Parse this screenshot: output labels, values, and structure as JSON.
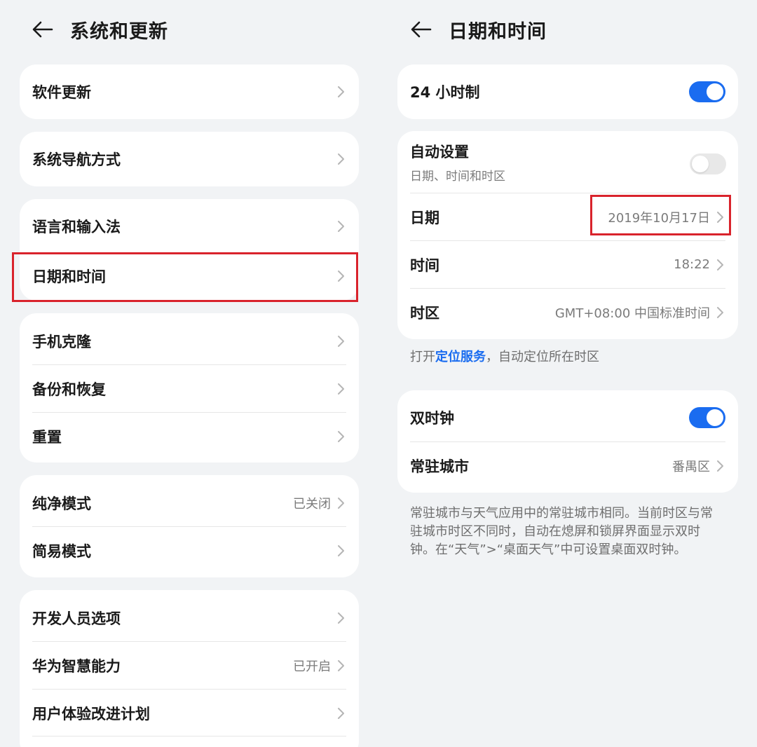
{
  "colors": {
    "background": "#f1f3f5",
    "accent": "#1a6cf0",
    "highlight": "#d9232c"
  },
  "left": {
    "title": "系统和更新",
    "rows": {
      "software_update": "软件更新",
      "system_navigation": "系统导航方式",
      "language_input": "语言和输入法",
      "date_time": "日期和时间",
      "phone_clone": "手机克隆",
      "backup_restore": "备份和恢复",
      "reset": "重置",
      "pure_mode": "纯净模式",
      "pure_mode_value": "已关闭",
      "simple_mode": "简易模式",
      "developer_options": "开发人员选项",
      "huawei_ai": "华为智慧能力",
      "huawei_ai_value": "已开启",
      "ux_plan": "用户体验改进计划"
    }
  },
  "right": {
    "title": "日期和时间",
    "hour24_label": "24 小时制",
    "hour24_on": true,
    "auto_label": "自动设置",
    "auto_sub": "日期、时间和时区",
    "auto_on": false,
    "date_label": "日期",
    "date_value": "2019年10月17日",
    "time_label": "时间",
    "time_value": "18:22",
    "timezone_label": "时区",
    "timezone_value": "GMT+08:00 中国标准时间",
    "location_note_prefix": "打开",
    "location_note_link": "定位服务",
    "location_note_suffix": "，自动定位所在时区",
    "dual_clock_label": "双时钟",
    "dual_clock_on": true,
    "home_city_label": "常驻城市",
    "home_city_value": "番禺区",
    "dual_clock_note": "常驻城市与天气应用中的常驻城市相同。当前时区与常驻城市时区不同时，自动在熄屏和锁屏界面显示双时钟。在“天气”>“桌面天气”中可设置桌面双时钟。"
  }
}
